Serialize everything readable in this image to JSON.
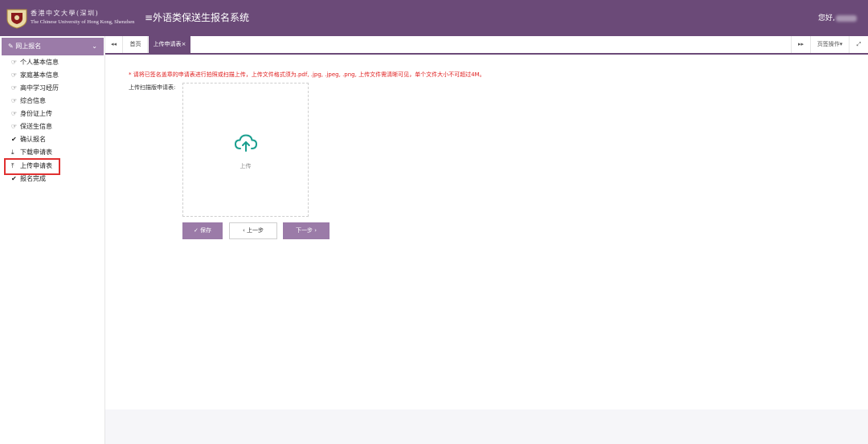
{
  "header": {
    "university_cn": "香港中文大學(深圳)",
    "university_en": "The Chinese University of Hong Kong, Shenzhen",
    "system_title": "≡外语类保送生报名系统",
    "greeting": "您好,"
  },
  "sidebar": {
    "section_label": "网上报名",
    "items": [
      {
        "label": "个人基本信息",
        "icon": "hand-icon"
      },
      {
        "label": "家庭基本信息",
        "icon": "hand-icon"
      },
      {
        "label": "高中学习经历",
        "icon": "hand-icon"
      },
      {
        "label": "综合信息",
        "icon": "hand-icon"
      },
      {
        "label": "身份证上传",
        "icon": "hand-icon"
      },
      {
        "label": "保送生信息",
        "icon": "hand-icon"
      },
      {
        "label": "确认报名",
        "icon": "check-icon"
      },
      {
        "label": "下载申请表",
        "icon": "download-icon"
      },
      {
        "label": "上传申请表",
        "icon": "upload-icon"
      },
      {
        "label": "报名完成",
        "icon": "check-icon"
      }
    ]
  },
  "tabs": {
    "home": "首页",
    "active": "上传申请表",
    "page_ops": "页签操作"
  },
  "main": {
    "notice": "* 请将已签名盖章的申请表进行拍照或扫描上传，上传文件格式须为.pdf, .jpg, .jpeg, .png, 上传文件需清晰可见，单个文件大小不可超过4M。",
    "upload_label": "上传扫描版申请表:",
    "upload_text": "上传",
    "save_label": "保存",
    "prev_label": "上一步",
    "next_label": "下一步"
  },
  "colors": {
    "header": "#6b4a78",
    "accent": "#9b7ba8",
    "notice": "#e02020",
    "cloud": "#1a9f8f"
  }
}
